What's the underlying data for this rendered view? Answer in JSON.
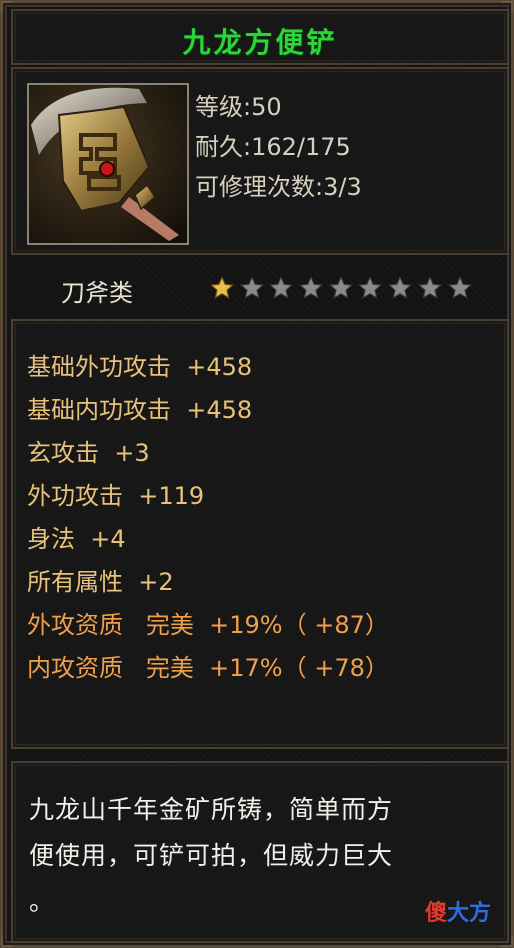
{
  "item": {
    "name": "九龙方便铲",
    "level_text": "等级:50",
    "durability_text": "耐久:162/175",
    "repair_text": "可修理次数:3/3",
    "category": "刀斧类",
    "stars": {
      "filled": 1,
      "total": 9
    },
    "attributes": [
      "基础外功攻击  +458",
      "基础内功攻击  +458",
      "玄攻击  +3",
      "外功攻击  +119",
      "身法  +4",
      "所有属性  +2",
      "外攻资质   完美  +19%（ +87）",
      "内攻资质   完美  +17%（ +78）"
    ],
    "description_line1": "九龙山千年金矿所铸，简单而方",
    "description_line2": "便使用，可铲可拍，但威力巨大",
    "description_line3": "。"
  },
  "watermark": {
    "part1": "傻",
    "part2": "大方"
  },
  "colors": {
    "title_green": "#2fd33a",
    "attr_gold": "#e8c27a",
    "attr_orange": "#f0a04a",
    "star_gold": "#e8c04a",
    "star_gray": "#8a8a8a"
  },
  "icons": {
    "item_icon": "shovel-icon",
    "star_filled": "star-filled-icon",
    "star_empty": "star-empty-icon"
  }
}
